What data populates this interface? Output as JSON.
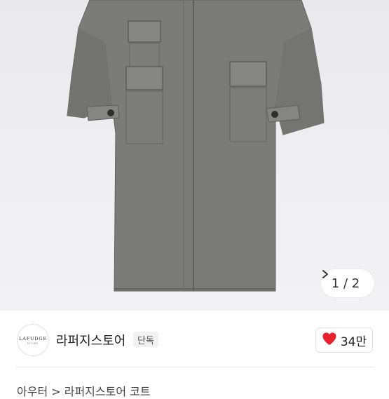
{
  "product": {
    "image_alt": "gray wool long coat",
    "colors": {
      "coat": "#7a7a78",
      "background": "#ededef"
    }
  },
  "gallery": {
    "pager_text": "1 / 2",
    "next_icon": "chevron-right-icon"
  },
  "store": {
    "logo_text": "LAFUDGE",
    "logo_subtext": "STORE",
    "name": "라퍼지스토어",
    "tag": "단독"
  },
  "likes": {
    "icon": "heart-icon",
    "count": "34만",
    "heart_color": "#e8232f"
  },
  "title_peek": "아우터 > 라퍼지스토어 코트"
}
